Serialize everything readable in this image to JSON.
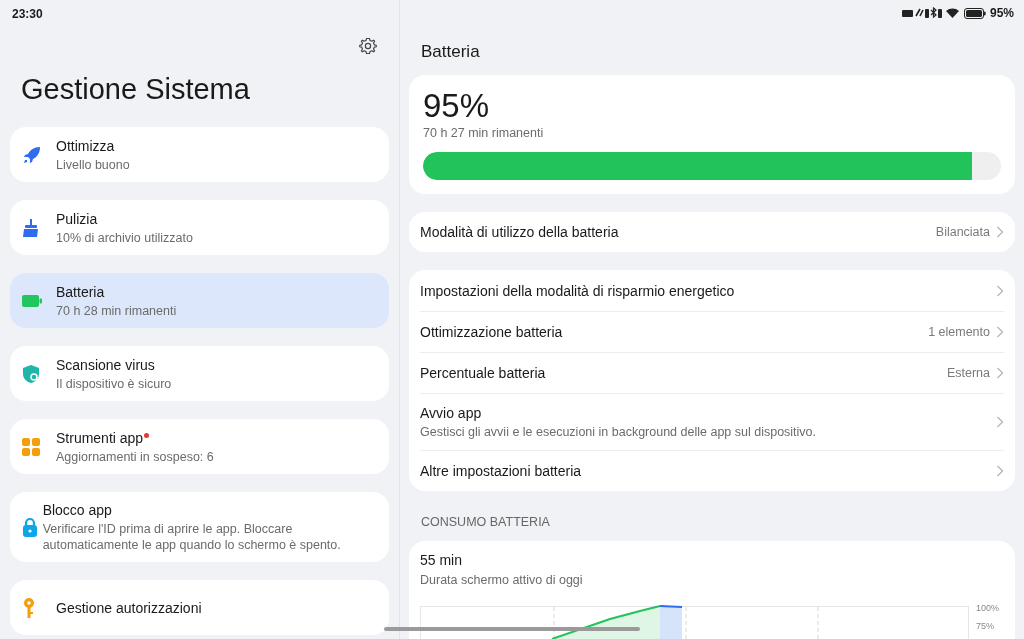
{
  "status_bar": {
    "time": "23:30",
    "battery_text": "95%"
  },
  "sidebar": {
    "title": "Gestione Sistema",
    "items": [
      {
        "kind": "rocket",
        "title": "Ottimizza",
        "subtitle": "Livello buono",
        "selected": false,
        "badge": false
      },
      {
        "kind": "broom",
        "title": "Pulizia",
        "subtitle": "10% di archivio utilizzato",
        "selected": false,
        "badge": false
      },
      {
        "kind": "battery",
        "title": "Batteria",
        "subtitle": "70 h 28 min rimanenti",
        "selected": true,
        "badge": false
      },
      {
        "kind": "shield",
        "title": "Scansione virus",
        "subtitle": "Il dispositivo è sicuro",
        "selected": false,
        "badge": false
      },
      {
        "kind": "grid",
        "title": "Strumenti app",
        "subtitle": "Aggiornamenti in sospeso: 6",
        "selected": false,
        "badge": true
      },
      {
        "kind": "lock",
        "title": "Blocco app",
        "subtitle": "Verificare l'ID prima di aprire le app. Bloccare automaticamente le app quando lo schermo è spento.",
        "selected": false,
        "badge": false
      },
      {
        "kind": "key",
        "title": "Gestione autorizzazioni",
        "selected": false,
        "badge": false
      }
    ]
  },
  "detail": {
    "title": "Batteria",
    "battery_card": {
      "percent": "95%",
      "remaining": "70 h 27 min rimanenti",
      "level": 0.95
    },
    "mode_row": {
      "label": "Modalità di utilizzo della batteria",
      "value": "Bilanciata"
    },
    "settings": [
      {
        "label": "Impostazioni della modalità di risparmio energetico"
      },
      {
        "label": "Ottimizzazione batteria",
        "value": "1 elemento"
      },
      {
        "label": "Percentuale batteria",
        "value": "Esterna"
      },
      {
        "label": "Avvio app",
        "description": "Gestisci gli avvii e le esecuzioni in background delle app sul dispositivo."
      },
      {
        "label": "Altre impostazioni batteria"
      }
    ],
    "usage_section": {
      "heading": "CONSUMO BATTERIA",
      "screen_time": "55 min",
      "screen_time_label": "Durata schermo attivo di oggi",
      "y_tick_labels": [
        "100%",
        "75%"
      ]
    }
  }
}
